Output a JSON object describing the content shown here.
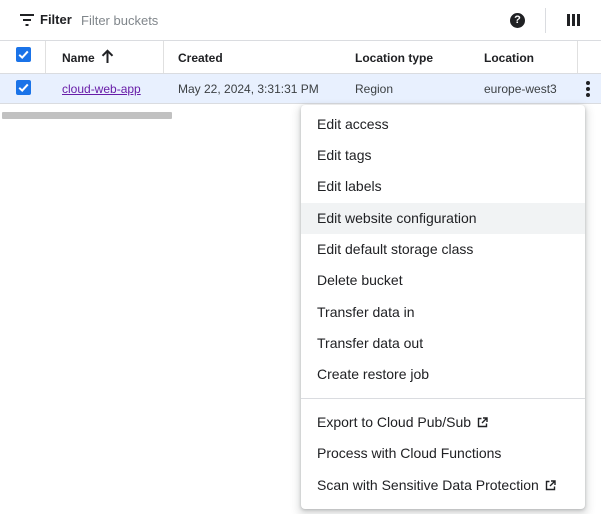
{
  "filter": {
    "label": "Filter",
    "placeholder": "Filter buckets"
  },
  "toolbar": {
    "help_icon": "?",
    "columns_icon": "column-display-icon"
  },
  "table": {
    "columns": [
      "Name",
      "Created",
      "Location type",
      "Location"
    ],
    "sort": {
      "column": "Name",
      "direction": "ascending"
    },
    "rows": [
      {
        "selected": true,
        "name": "cloud-web-app",
        "created": "May 22, 2024, 3:31:31 PM",
        "location_type": "Region",
        "location": "europe-west3"
      }
    ]
  },
  "menu": {
    "hovered_item": "Edit website configuration",
    "items": [
      "Edit access",
      "Edit tags",
      "Edit labels",
      "Edit website configuration",
      "Edit default storage class",
      "Delete bucket",
      "Transfer data in",
      "Transfer data out",
      "Create restore job"
    ],
    "external_items": [
      {
        "label": "Export to Cloud Pub/Sub",
        "external": true
      },
      {
        "label": "Process with Cloud Functions",
        "external": false
      },
      {
        "label": "Scan with Sensitive Data Protection",
        "external": true
      }
    ]
  },
  "colors": {
    "accent": "#1a73e8",
    "link_visited": "#681da8",
    "selected_row": "#e8f0fe",
    "menu_hover": "#f1f3f4"
  }
}
